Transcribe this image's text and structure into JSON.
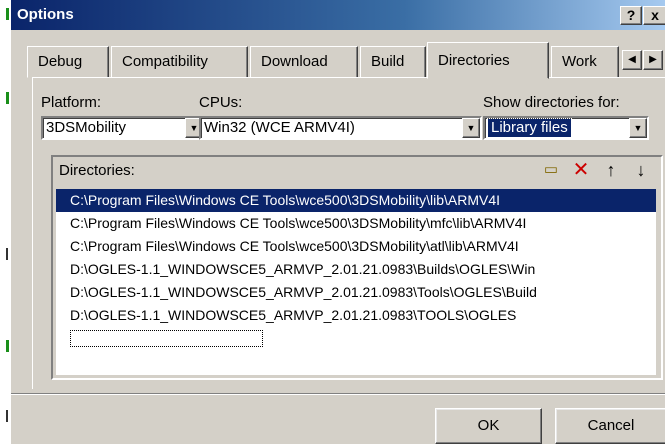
{
  "window": {
    "title": "Options",
    "help_button": "?",
    "close_button": "x"
  },
  "tabs": [
    {
      "label": "Debug",
      "active": false
    },
    {
      "label": "Compatibility",
      "active": false
    },
    {
      "label": "Download",
      "active": false
    },
    {
      "label": "Build",
      "active": false
    },
    {
      "label": "Directories",
      "active": true
    },
    {
      "label": "Work",
      "active": false
    }
  ],
  "platform": {
    "label": "Platform:",
    "value": "3DSMobility"
  },
  "cpus": {
    "label": "CPUs:",
    "value": "Win32 (WCE ARMV4I)"
  },
  "show_dirs": {
    "label": "Show directories for:",
    "value": "Library files"
  },
  "directories": {
    "label": "Directories:",
    "items": [
      "C:\\Program Files\\Windows CE Tools\\wce500\\3DSMobility\\lib\\ARMV4I",
      "C:\\Program Files\\Windows CE Tools\\wce500\\3DSMobility\\mfc\\lib\\ARMV4I",
      "C:\\Program Files\\Windows CE Tools\\wce500\\3DSMobility\\atl\\lib\\ARMV4I",
      "D:\\OGLES-1.1_WINDOWSCE5_ARMVP_2.01.21.0983\\Builds\\OGLES\\Win",
      "D:\\OGLES-1.1_WINDOWSCE5_ARMVP_2.01.21.0983\\Tools\\OGLES\\Build",
      "D:\\OGLES-1.1_WINDOWSCE5_ARMVP_2.01.21.0983\\TOOLS\\OGLES"
    ],
    "selected_index": 0
  },
  "toolbar_icons": [
    "new-folder-icon",
    "delete-icon",
    "move-up-icon",
    "move-down-icon"
  ],
  "buttons": {
    "ok": "OK",
    "cancel": "Cancel"
  },
  "colors": {
    "titlebar": "#0a246a",
    "face": "#d4d0c8",
    "selection": "#0a246a"
  }
}
